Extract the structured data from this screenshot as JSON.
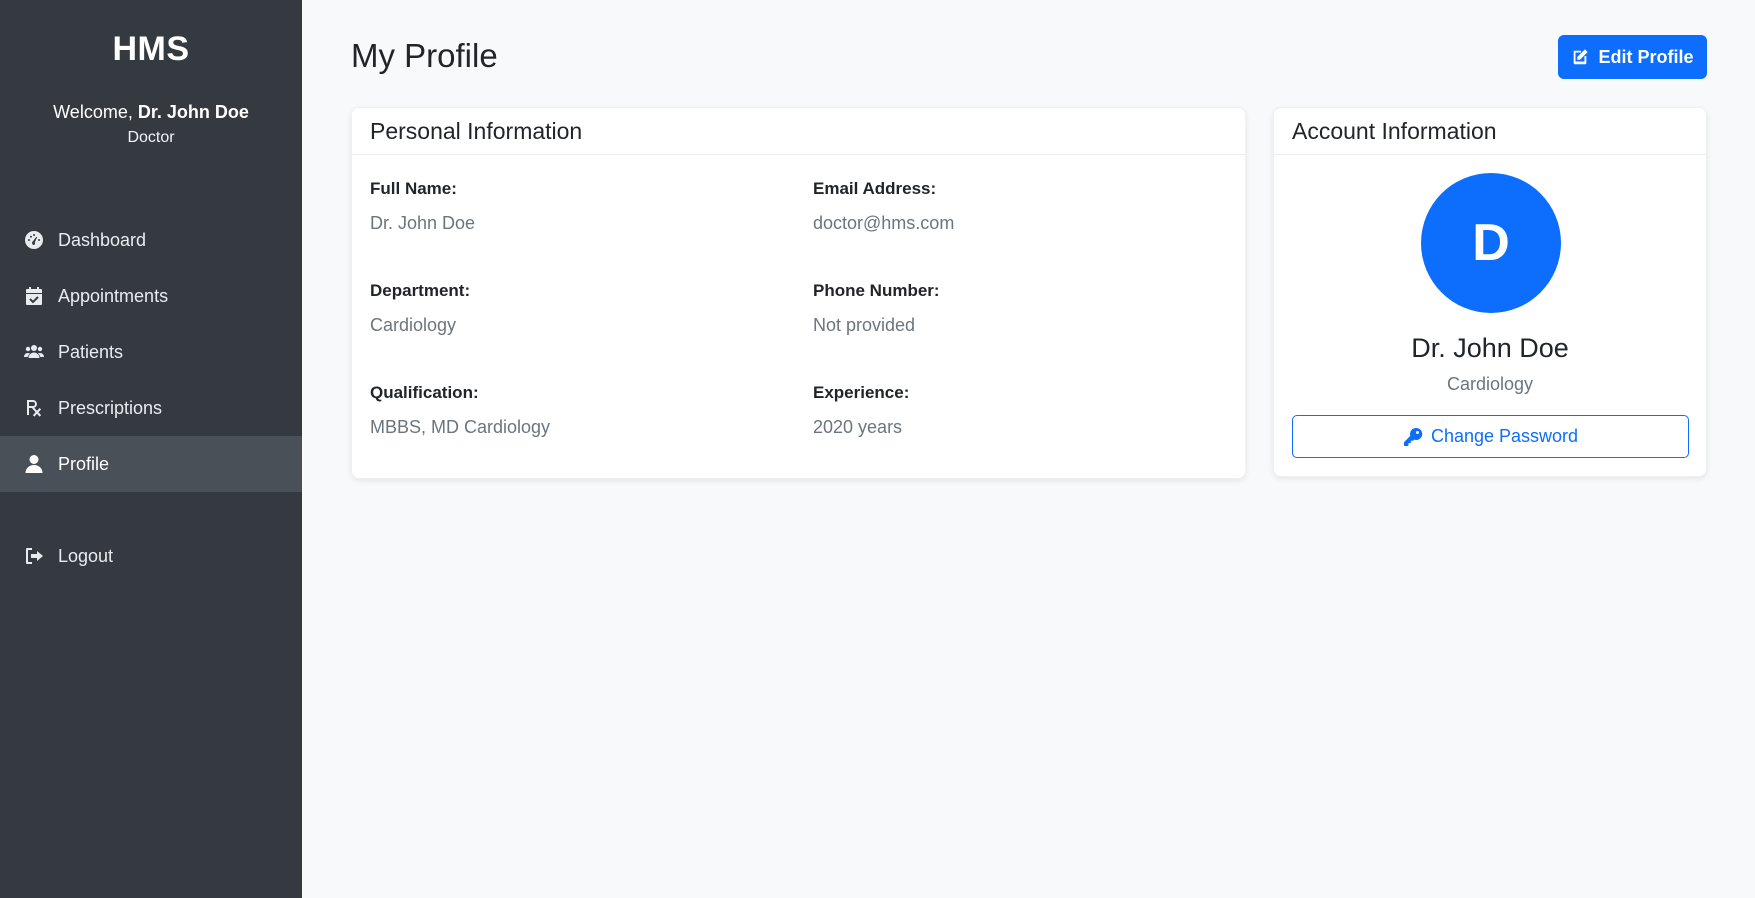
{
  "sidebar": {
    "brand": "HMS",
    "welcome_prefix": "Welcome, ",
    "user_name": "Dr. John Doe",
    "role": "Doctor",
    "items": [
      {
        "label": "Dashboard",
        "icon": "dashboard-gauge-icon"
      },
      {
        "label": "Appointments",
        "icon": "calendar-check-icon"
      },
      {
        "label": "Patients",
        "icon": "users-icon"
      },
      {
        "label": "Prescriptions",
        "icon": "prescription-icon"
      },
      {
        "label": "Profile",
        "icon": "user-icon",
        "active": true
      }
    ],
    "logout": {
      "label": "Logout",
      "icon": "sign-out-icon"
    }
  },
  "header": {
    "title": "My Profile",
    "edit_button": "Edit Profile"
  },
  "personal": {
    "title": "Personal Information",
    "full_name_label": "Full Name:",
    "full_name": "Dr. John Doe",
    "email_label": "Email Address:",
    "email": "doctor@hms.com",
    "department_label": "Department:",
    "department": "Cardiology",
    "phone_label": "Phone Number:",
    "phone": "Not provided",
    "qualification_label": "Qualification:",
    "qualification": "MBBS, MD Cardiology",
    "experience_label": "Experience:",
    "experience": "2020 years"
  },
  "account": {
    "title": "Account Information",
    "avatar_initial": "D",
    "name": "Dr. John Doe",
    "department": "Cardiology",
    "change_password": "Change Password"
  },
  "colors": {
    "sidebar_bg": "#343a40",
    "sidebar_active": "#495057",
    "primary": "#0d6efd",
    "page_bg": "#f8f9fa",
    "muted_text": "#6c757d"
  }
}
